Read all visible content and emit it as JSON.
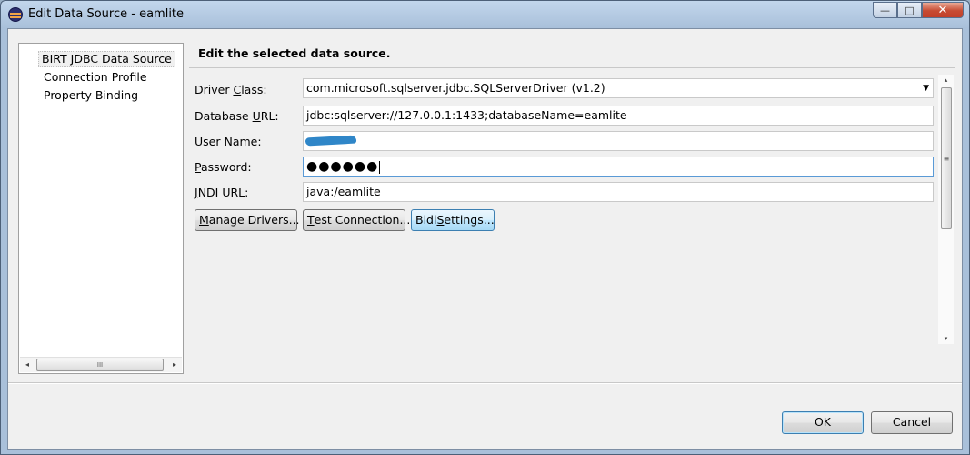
{
  "window": {
    "title": "Edit Data Source - eamlite",
    "app_icon": "eclipse-icon",
    "minimize_glyph": "—",
    "maximize_glyph": "□",
    "close_glyph": "✕"
  },
  "tree": {
    "items": [
      {
        "label": "BIRT JDBC Data Source",
        "selected": true
      },
      {
        "label": "Connection Profile",
        "selected": false
      },
      {
        "label": "Property Binding",
        "selected": false
      }
    ],
    "scroll_left": "◂",
    "scroll_right": "▸",
    "scroll_grip": "III"
  },
  "page": {
    "header": "Edit the selected data source.",
    "fields": {
      "driver_class": {
        "pre": "Driver ",
        "mnemonic": "C",
        "post": "lass:",
        "value": "com.microsoft.sqlserver.jdbc.SQLServerDriver (v1.2)",
        "dropdown_glyph": "▼"
      },
      "database_url": {
        "pre": "Database ",
        "mnemonic": "U",
        "post": "RL:",
        "value": "jdbc:sqlserver://127.0.0.1:1433;databaseName=eamlite"
      },
      "user_name": {
        "pre": "User Na",
        "mnemonic": "m",
        "post": "e:",
        "value": ""
      },
      "password": {
        "pre": "",
        "mnemonic": "P",
        "post": "assword:",
        "value": "●●●●●●"
      },
      "jndi_url": {
        "pre": "",
        "mnemonic": "J",
        "post": "NDI URL:",
        "value": "java:/eamlite"
      }
    },
    "buttons": {
      "manage_drivers": {
        "pre": "",
        "mnemonic": "M",
        "post": "anage Drivers..."
      },
      "test_connection": {
        "pre": "",
        "mnemonic": "T",
        "post": "est Connection..."
      },
      "bidi_settings": {
        "pre": "Bidi ",
        "mnemonic": "S",
        "post": "ettings..."
      }
    },
    "scroll_up": "▴",
    "scroll_down": "▾",
    "scroll_grip": "≡"
  },
  "footer": {
    "ok_label": "OK",
    "cancel_label": "Cancel"
  }
}
